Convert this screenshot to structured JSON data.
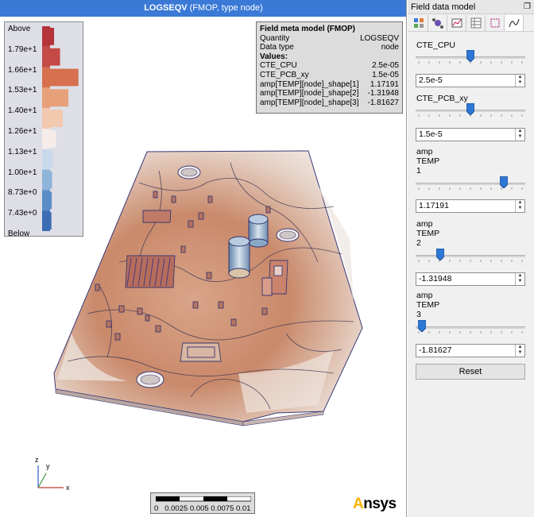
{
  "viewport": {
    "title_bold": "LOGSEQV",
    "title_rest": " (FMOP, type node)"
  },
  "legend": {
    "labels": [
      "Above",
      "1.79e+1",
      "1.66e+1",
      "1.53e+1",
      "1.40e+1",
      "1.26e+1",
      "1.13e+1",
      "1.00e+1",
      "8.73e+0",
      "7.43e+0",
      "Below"
    ],
    "histogram": [
      0.12,
      0.3,
      0.85,
      0.55,
      0.38,
      0.18,
      0.08,
      0.06,
      0.05,
      0.04
    ],
    "colors": [
      "#b4343a",
      "#c44a45",
      "#d6704e",
      "#e8a07a",
      "#f2c8ae",
      "#f6ecea",
      "#c9d9ec",
      "#8fb4da",
      "#5a8ec8",
      "#3b6db5"
    ]
  },
  "meta": {
    "title": "Field meta model (FMOP)",
    "quantity_label": "Quantity",
    "quantity_value": "LOGSEQV",
    "datatype_label": "Data type",
    "datatype_value": "node",
    "values_label": "Values:",
    "values": [
      {
        "name": "CTE_CPU",
        "value": "2.5e-05"
      },
      {
        "name": "CTE_PCB_xy",
        "value": "1.5e-05"
      },
      {
        "name": "amp[TEMP][node]_shape[1]",
        "value": "1.17191"
      },
      {
        "name": "amp[TEMP][node]_shape[2]",
        "value": "-1.31948"
      },
      {
        "name": "amp[TEMP][node]_shape[3]",
        "value": "-1.81627"
      }
    ]
  },
  "axes": {
    "z": "z",
    "y": "y",
    "x": "x"
  },
  "scalebar": {
    "ticks": "0   0.0025 0.005 0.0075 0.01"
  },
  "logo": {
    "first": "A",
    "rest": "nsys"
  },
  "panel": {
    "title": "Field data model",
    "float_icon": "restore-icon",
    "reset_label": "Reset",
    "params": [
      {
        "label_lines": [
          "CTE_CPU"
        ],
        "value": "2.5e-5",
        "slider_fraction": 0.5
      },
      {
        "label_lines": [
          "CTE_PCB_xy"
        ],
        "value": "1.5e-5",
        "slider_fraction": 0.5
      },
      {
        "label_lines": [
          "amp",
          "TEMP",
          "1"
        ],
        "value": "1.17191",
        "slider_fraction": 0.83
      },
      {
        "label_lines": [
          "amp",
          "TEMP",
          "2"
        ],
        "value": "-1.31948",
        "slider_fraction": 0.2
      },
      {
        "label_lines": [
          "amp",
          "TEMP",
          "3"
        ],
        "value": "-1.81627",
        "slider_fraction": 0.02
      }
    ],
    "toolbar_icons": [
      "view-icon",
      "network-icon",
      "chart-icon",
      "table-icon",
      "selection-icon",
      "wave-icon"
    ]
  }
}
